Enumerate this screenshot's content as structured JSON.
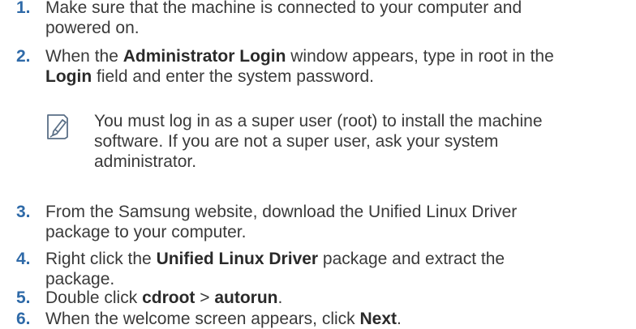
{
  "steps": [
    {
      "number": "1.",
      "lines": [
        [
          {
            "t": "Make sure that the machine is connected to your computer and",
            "b": false
          }
        ],
        [
          {
            "t": "powered on.",
            "b": false
          }
        ]
      ]
    },
    {
      "number": "2.",
      "lines": [
        [
          {
            "t": "When the ",
            "b": false
          },
          {
            "t": "Administrator Login",
            "b": true
          },
          {
            "t": " window appears, type in root in the",
            "b": false
          }
        ],
        [
          {
            "t": "Login",
            "b": true
          },
          {
            "t": " field and enter the system password.",
            "b": false
          }
        ]
      ]
    },
    {
      "number": "3.",
      "lines": [
        [
          {
            "t": "From the Samsung website, download the Unified Linux Driver",
            "b": false
          }
        ],
        [
          {
            "t": "package to your computer.",
            "b": false
          }
        ]
      ]
    },
    {
      "number": "4.",
      "lines": [
        [
          {
            "t": "Right click the ",
            "b": false
          },
          {
            "t": "Unified Linux Driver",
            "b": true
          },
          {
            "t": " package and extract the",
            "b": false
          }
        ],
        [
          {
            "t": "package.",
            "b": false
          }
        ]
      ]
    },
    {
      "number": "5.",
      "lines": [
        [
          {
            "t": "Double click ",
            "b": false
          },
          {
            "t": "cdroot",
            "b": true
          },
          {
            "t": " > ",
            "b": false
          },
          {
            "t": "autorun",
            "b": true
          },
          {
            "t": ".",
            "b": false
          }
        ]
      ]
    },
    {
      "number": "6.",
      "lines": [
        [
          {
            "t": "When the welcome screen appears, click ",
            "b": false
          },
          {
            "t": "Next",
            "b": true
          },
          {
            "t": ".",
            "b": false
          }
        ]
      ]
    }
  ],
  "note": {
    "icon": "note-pencil-icon",
    "lines": [
      "You must log in as a super user (root) to install the machine",
      "software. If you are not a super user, ask your system",
      "administrator."
    ]
  },
  "colors": {
    "number": "#2f6aa8",
    "text": "#3a3a3a",
    "icon": "#5a6f86"
  }
}
